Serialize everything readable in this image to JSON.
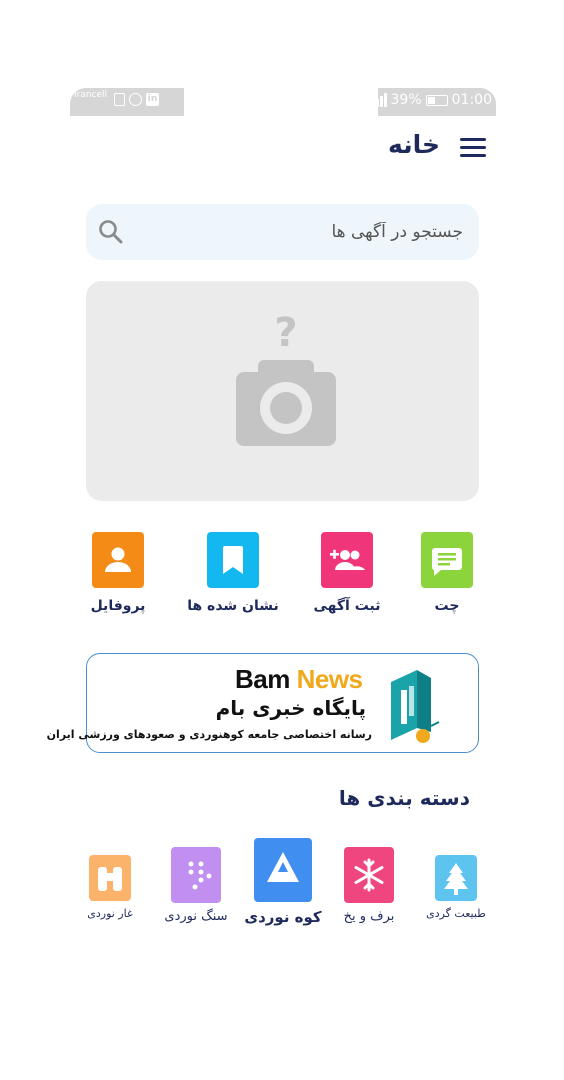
{
  "status_bar": {
    "carrier": "Irancell",
    "battery": "39%",
    "time": "01:00"
  },
  "header": {
    "title": "خانه",
    "menu_icon": "hamburger-menu-icon"
  },
  "search": {
    "placeholder": "جستجو در آگهی ها",
    "icon": "search-icon"
  },
  "banner": {
    "icon": "camera-question-icon"
  },
  "quick_actions": [
    {
      "label": "چت",
      "icon": "chat-icon",
      "color": "#8bd43b"
    },
    {
      "label": "ثبت آگهی",
      "icon": "add-user-icon",
      "color": "#f0357a"
    },
    {
      "label": "نشان شده ها",
      "icon": "bookmark-icon",
      "color": "#14b8f0"
    },
    {
      "label": "پروفایل",
      "icon": "person-icon",
      "color": "#f58b17"
    }
  ],
  "ad": {
    "brand_part1": "Bam",
    "brand_part2": "News",
    "title_fa": "پایگاه خبری بام",
    "subtitle_fa": "رسانه اختصاصی جامعه کوهنوردی و صعودهای ورزشی ایران"
  },
  "categories": {
    "title": "دسته بندی ها",
    "items": [
      {
        "label": "طبیعت گردی",
        "icon": "tree-icon",
        "color": "#5cc4ef"
      },
      {
        "label": "برف و یخ",
        "icon": "snowflake-icon",
        "color": "#f0467f"
      },
      {
        "label": "کوه نوردی",
        "icon": "mountain-icon",
        "color": "#3f8ef0"
      },
      {
        "label": "سنگ نوردی",
        "icon": "rock-holds-icon",
        "color": "#c08ff0"
      },
      {
        "label": "غار نوردی",
        "icon": "binoculars-icon",
        "color": "#fbb36c"
      }
    ]
  }
}
